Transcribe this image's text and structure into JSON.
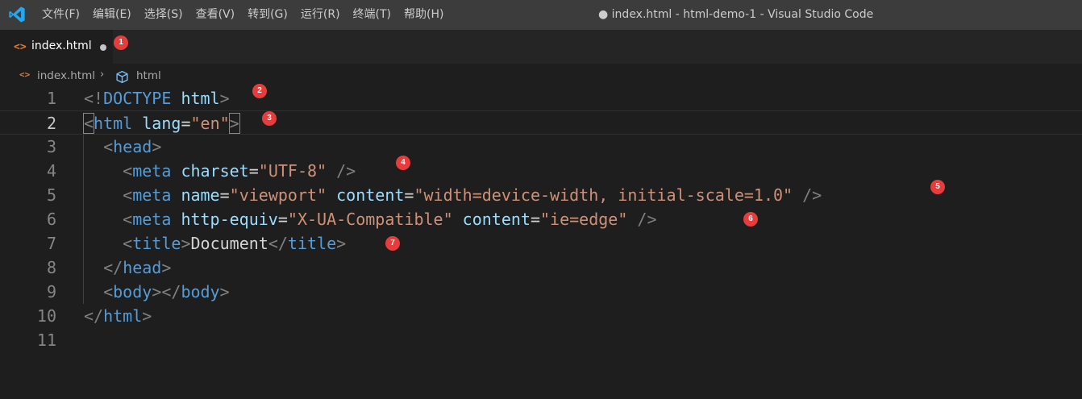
{
  "window": {
    "title": "● index.html - html-demo-1 - Visual Studio Code",
    "menu": [
      "文件(F)",
      "编辑(E)",
      "选择(S)",
      "查看(V)",
      "转到(G)",
      "运行(R)",
      "终端(T)",
      "帮助(H)"
    ]
  },
  "tab": {
    "icon": "html-file-icon",
    "label": "index.html",
    "dirty": true
  },
  "breadcrumb": {
    "file": "index.html",
    "separator": "›",
    "node": "html"
  },
  "badges": [
    "1",
    "2",
    "3",
    "4",
    "5",
    "6",
    "7"
  ],
  "editor": {
    "active_line": 2,
    "line_numbers": [
      "1",
      "2",
      "3",
      "4",
      "5",
      "6",
      "7",
      "8",
      "9",
      "10",
      "11"
    ],
    "lines": [
      "<!DOCTYPE html>",
      "<html lang=\"en\">",
      "  <head>",
      "    <meta charset=\"UTF-8\" />",
      "    <meta name=\"viewport\" content=\"width=device-width, initial-scale=1.0\" />",
      "    <meta http-equiv=\"X-UA-Compatible\" content=\"ie=edge\" />",
      "    <title>Document</title>",
      "  </head>",
      "  <body></body>",
      "</html>",
      ""
    ]
  },
  "colors": {
    "titlebar": "#3c3c3c",
    "editor_bg": "#1e1e1e",
    "tag": "#569cd6",
    "attribute": "#9cdcfe",
    "string": "#ce9178",
    "badge": "#e63c3c",
    "html_icon": "#e37933"
  }
}
